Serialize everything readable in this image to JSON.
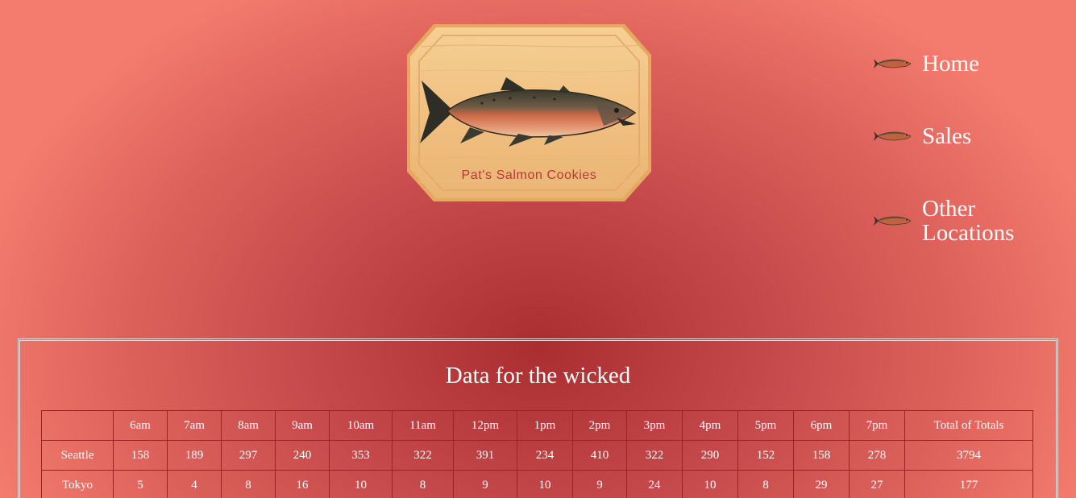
{
  "brand": {
    "logo_text": "Pat's Salmon Cookies",
    "logo_icon": "salmon-plaque-icon"
  },
  "nav": {
    "items": [
      {
        "label": "Home",
        "icon": "salmon-icon"
      },
      {
        "label": "Sales",
        "icon": "salmon-icon"
      },
      {
        "label": "Other Locations",
        "icon": "salmon-icon"
      }
    ]
  },
  "section": {
    "title": "Data for the wicked"
  },
  "table": {
    "headers": [
      "",
      "6am",
      "7am",
      "8am",
      "9am",
      "10am",
      "11am",
      "12pm",
      "1pm",
      "2pm",
      "3pm",
      "4pm",
      "5pm",
      "6pm",
      "7pm",
      "Total of Totals"
    ],
    "rows": [
      [
        "Seattle",
        "158",
        "189",
        "297",
        "240",
        "353",
        "322",
        "391",
        "234",
        "410",
        "322",
        "290",
        "152",
        "158",
        "278",
        "3794"
      ],
      [
        "Tokyo",
        "5",
        "4",
        "8",
        "16",
        "10",
        "8",
        "9",
        "10",
        "9",
        "24",
        "10",
        "8",
        "29",
        "27",
        "177"
      ]
    ]
  },
  "colors": {
    "background_center": "#aa2e30",
    "background_edge": "#f47c6e",
    "table_border": "#9c2224",
    "text": "#ffffff",
    "logo_text": "#b8383a",
    "plaque_wood": "#f2c48a"
  }
}
